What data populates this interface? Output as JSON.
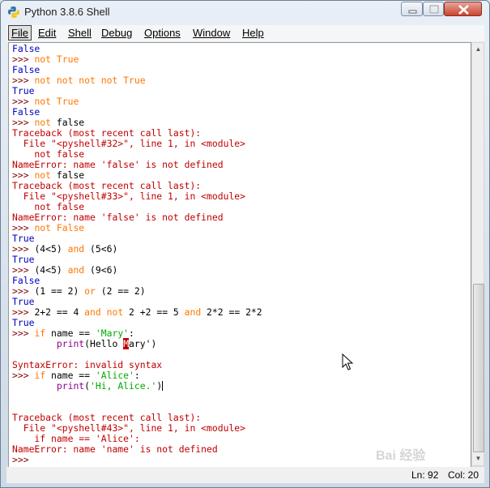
{
  "window": {
    "title": "Python 3.8.6 Shell"
  },
  "menu": [
    "File",
    "Edit",
    "Shell",
    "Debug",
    "Options",
    "Window",
    "Help"
  ],
  "status": {
    "line": "Ln: 92",
    "col": "Col: 20"
  },
  "watermark": "Bai 经验",
  "shell_lines": [
    [
      [
        "o",
        "False"
      ]
    ],
    [
      [
        "p",
        ">>> "
      ],
      [
        "k",
        "not"
      ],
      [
        "k",
        " True"
      ]
    ],
    [
      [
        "o",
        "False"
      ]
    ],
    [
      [
        "p",
        ">>> "
      ],
      [
        "k",
        "not not not not"
      ],
      [
        "k",
        " True"
      ]
    ],
    [
      [
        "o",
        "True"
      ]
    ],
    [
      [
        "p",
        ">>> "
      ],
      [
        "k",
        "not"
      ],
      [
        "k",
        " True"
      ]
    ],
    [
      [
        "o",
        "False"
      ]
    ],
    [
      [
        "p",
        ">>> "
      ],
      [
        "k",
        "not"
      ],
      [
        "n",
        " false"
      ]
    ],
    [
      [
        "e",
        "Traceback (most recent call last):"
      ]
    ],
    [
      [
        "e",
        "  File \"<pyshell#32>\", line 1, in <module>"
      ]
    ],
    [
      [
        "e",
        "    not false"
      ]
    ],
    [
      [
        "e",
        "NameError: name 'false' is not defined"
      ]
    ],
    [
      [
        "p",
        ">>> "
      ],
      [
        "k",
        "not"
      ],
      [
        "n",
        " false"
      ]
    ],
    [
      [
        "e",
        "Traceback (most recent call last):"
      ]
    ],
    [
      [
        "e",
        "  File \"<pyshell#33>\", line 1, in <module>"
      ]
    ],
    [
      [
        "e",
        "    not false"
      ]
    ],
    [
      [
        "e",
        "NameError: name 'false' is not defined"
      ]
    ],
    [
      [
        "p",
        ">>> "
      ],
      [
        "k",
        "not"
      ],
      [
        "k",
        " False"
      ]
    ],
    [
      [
        "o",
        "True"
      ]
    ],
    [
      [
        "p",
        ">>> "
      ],
      [
        "n",
        "(4<5) "
      ],
      [
        "k",
        "and"
      ],
      [
        "n",
        " (5<6)"
      ]
    ],
    [
      [
        "o",
        "True"
      ]
    ],
    [
      [
        "p",
        ">>> "
      ],
      [
        "n",
        "(4<5) "
      ],
      [
        "k",
        "and"
      ],
      [
        "n",
        " (9<6)"
      ]
    ],
    [
      [
        "o",
        "False"
      ]
    ],
    [
      [
        "p",
        ">>> "
      ],
      [
        "n",
        "(1 == 2) "
      ],
      [
        "k",
        "or"
      ],
      [
        "n",
        " (2 == 2)"
      ]
    ],
    [
      [
        "o",
        "True"
      ]
    ],
    [
      [
        "p",
        ">>> "
      ],
      [
        "n",
        "2+2 == 4 "
      ],
      [
        "k",
        "and not"
      ],
      [
        "n",
        " 2 +2 == 5 "
      ],
      [
        "k",
        "and"
      ],
      [
        "n",
        " 2*2 == 2*2"
      ]
    ],
    [
      [
        "o",
        "True"
      ]
    ],
    [
      [
        "p",
        ">>> "
      ],
      [
        "k",
        "if"
      ],
      [
        "n",
        " name == "
      ],
      [
        "s",
        "'Mary'"
      ],
      [
        "n",
        ":"
      ]
    ],
    [
      [
        "n",
        "        "
      ],
      [
        "b",
        "print"
      ],
      [
        "n",
        "(Hello "
      ],
      [
        "hl",
        "M"
      ],
      [
        "n",
        "ary')"
      ]
    ],
    [
      [
        "n",
        ""
      ]
    ],
    [
      [
        "e",
        "SyntaxError: invalid syntax"
      ]
    ],
    [
      [
        "p",
        ">>> "
      ],
      [
        "k",
        "if"
      ],
      [
        "n",
        " name == "
      ],
      [
        "s",
        "'Alice'"
      ],
      [
        "n",
        ":"
      ]
    ],
    [
      [
        "n",
        "        "
      ],
      [
        "b",
        "print"
      ],
      [
        "n",
        "("
      ],
      [
        "s",
        "'Hi, Alice.'"
      ],
      [
        "n",
        ")"
      ],
      [
        "caret",
        ""
      ]
    ],
    [
      [
        "n",
        ""
      ]
    ],
    [
      [
        "n",
        ""
      ]
    ],
    [
      [
        "e",
        "Traceback (most recent call last):"
      ]
    ],
    [
      [
        "e",
        "  File \"<pyshell#43>\", line 1, in <module>"
      ]
    ],
    [
      [
        "e",
        "    if name == 'Alice':"
      ]
    ],
    [
      [
        "e",
        "NameError: name 'name' is not defined"
      ]
    ],
    [
      [
        "p",
        ">>> "
      ]
    ]
  ]
}
